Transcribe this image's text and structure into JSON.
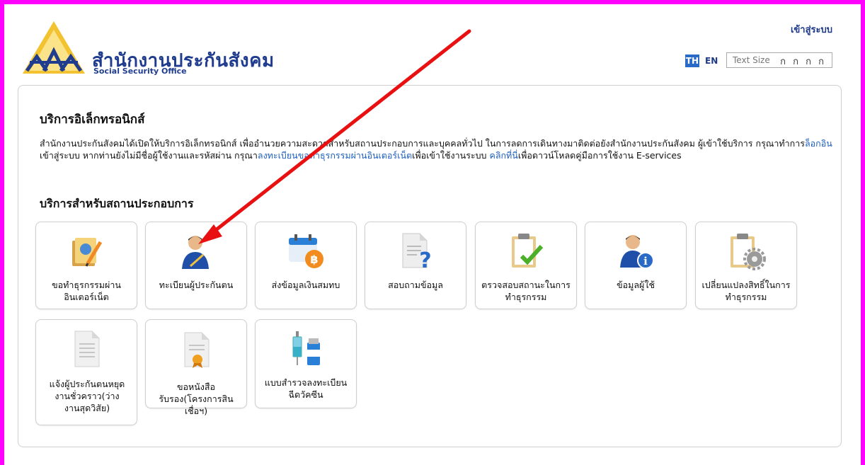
{
  "header": {
    "org_name_th": "สำนักงานประกันสังคม",
    "org_name_en": "Social Security Office",
    "login_link": "เข้าสู่ระบบ",
    "lang_th": "TH",
    "lang_en": "EN",
    "text_size_label": "Text Size",
    "text_size_glyphs": "ก ก ก ก"
  },
  "main": {
    "title": "บริการอิเล็กทรอนิกส์",
    "desc_part1": "สำนักงานประกันสังคมได้เปิดให้บริการอิเล็กทรอนิกส์ เพื่ออำนวยความสะดวกสำหรับสถานประกอบการและบุคคลทั่วไป ในการลดการเดินทางมาติดต่อยังสำนักงานประกันสังคม ผู้เข้าใช้บริการ กรุณาทำการ",
    "desc_link_login": "ล็อกอิน",
    "desc_part2": "เข้าสู่ระบบ หากท่านยังไม่มีชื่อผู้ใช้งานและรหัสผ่าน กรุณา",
    "desc_link_register": "ลงทะเบียนขอทำธุรกรรมผ่านอินเตอร์เน็ต",
    "desc_part3": "เพื่อเข้าใช้งานระบบ ",
    "desc_link_click": "คลิกที่นี่",
    "desc_part4": "เพื่อดาวน์โหลดคู่มือการใช้งาน E-services",
    "section_title": "บริการสำหรับสถานประกอบการ"
  },
  "tiles": [
    {
      "label": "ขอทำธุรกรรมผ่านอินเตอร์เน็ต",
      "icon": "folder-pencil-icon"
    },
    {
      "label": "ทะเบียนผู้ประกันตน",
      "icon": "person-pen-icon"
    },
    {
      "label": "ส่งข้อมูลเงินสมทบ",
      "icon": "calendar-baht-icon"
    },
    {
      "label": "สอบถามข้อมูล",
      "icon": "document-question-icon"
    },
    {
      "label": "ตรวจสอบสถานะในการทำธุรกรรม",
      "icon": "clipboard-check-icon"
    },
    {
      "label": "ข้อมูลผู้ใช้",
      "icon": "user-info-icon"
    },
    {
      "label": "เปลี่ยนแปลงสิทธิ์ในการทำธุรกรรม",
      "icon": "clipboard-gear-icon"
    },
    {
      "label": "แจ้งผู้ประกันตนหยุดงานชั่วคราว(ว่างงานสุดวิสัย)",
      "icon": "document-icon"
    },
    {
      "label": "ขอหนังสือรับรอง(โครงการสินเชื่อฯ)",
      "icon": "certificate-icon"
    },
    {
      "label": "แบบสำรวจลงทะเบียนฉีดวัคซีน",
      "icon": "vaccine-icon"
    }
  ],
  "colors": {
    "frame": "#ff00ff",
    "arrow": "#e81010",
    "link": "#1e5fbf",
    "brand": "#1f3c8f"
  }
}
